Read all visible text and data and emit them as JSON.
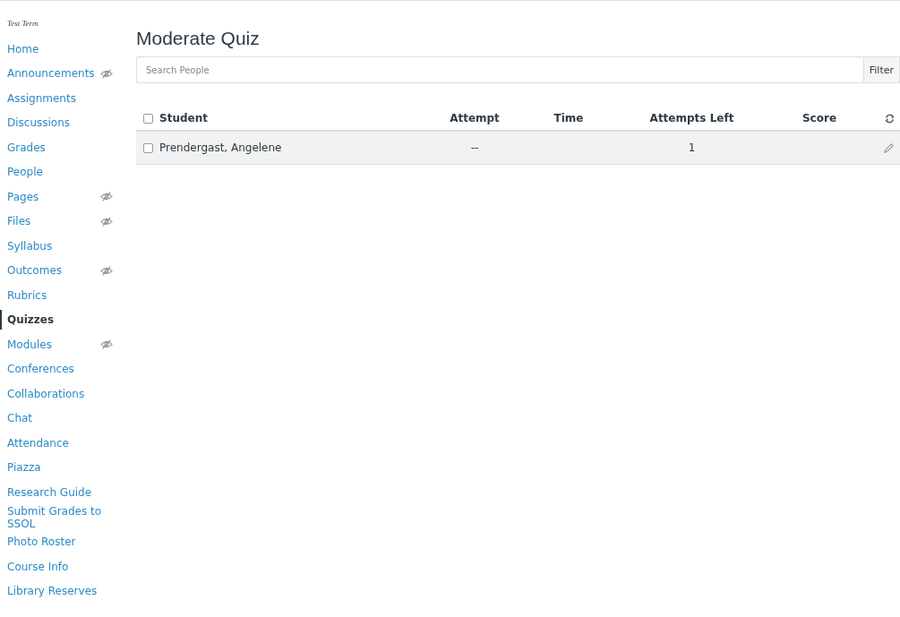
{
  "sidebar": {
    "term": "Test Term",
    "items": [
      {
        "label": "Home",
        "hidden": false,
        "selected": false
      },
      {
        "label": "Announcements",
        "hidden": true,
        "selected": false
      },
      {
        "label": "Assignments",
        "hidden": false,
        "selected": false
      },
      {
        "label": "Discussions",
        "hidden": false,
        "selected": false
      },
      {
        "label": "Grades",
        "hidden": false,
        "selected": false
      },
      {
        "label": "People",
        "hidden": false,
        "selected": false
      },
      {
        "label": "Pages",
        "hidden": true,
        "selected": false
      },
      {
        "label": "Files",
        "hidden": true,
        "selected": false
      },
      {
        "label": "Syllabus",
        "hidden": false,
        "selected": false
      },
      {
        "label": "Outcomes",
        "hidden": true,
        "selected": false
      },
      {
        "label": "Rubrics",
        "hidden": false,
        "selected": false
      },
      {
        "label": "Quizzes",
        "hidden": false,
        "selected": true
      },
      {
        "label": "Modules",
        "hidden": true,
        "selected": false
      },
      {
        "label": "Conferences",
        "hidden": false,
        "selected": false
      },
      {
        "label": "Collaborations",
        "hidden": false,
        "selected": false
      },
      {
        "label": "Chat",
        "hidden": false,
        "selected": false
      },
      {
        "label": "Attendance",
        "hidden": false,
        "selected": false
      },
      {
        "label": "Piazza",
        "hidden": false,
        "selected": false
      },
      {
        "label": "Research Guide",
        "hidden": false,
        "selected": false
      },
      {
        "label": "Submit Grades to SSOL",
        "hidden": false,
        "selected": false
      },
      {
        "label": "Photo Roster",
        "hidden": false,
        "selected": false
      },
      {
        "label": "Course Info",
        "hidden": false,
        "selected": false
      },
      {
        "label": "Library Reserves",
        "hidden": false,
        "selected": false
      }
    ]
  },
  "title": "Moderate Quiz",
  "search": {
    "placeholder": "Search People",
    "button": "Filter"
  },
  "table": {
    "select_all_checked": false,
    "columns": [
      "Student",
      "Attempt",
      "Time",
      "Attempts Left",
      "Score"
    ],
    "rows": [
      {
        "checked": false,
        "student": "Prendergast, Angelene",
        "attempt": "--",
        "time": "",
        "attempts_left": "1",
        "score": ""
      }
    ]
  }
}
